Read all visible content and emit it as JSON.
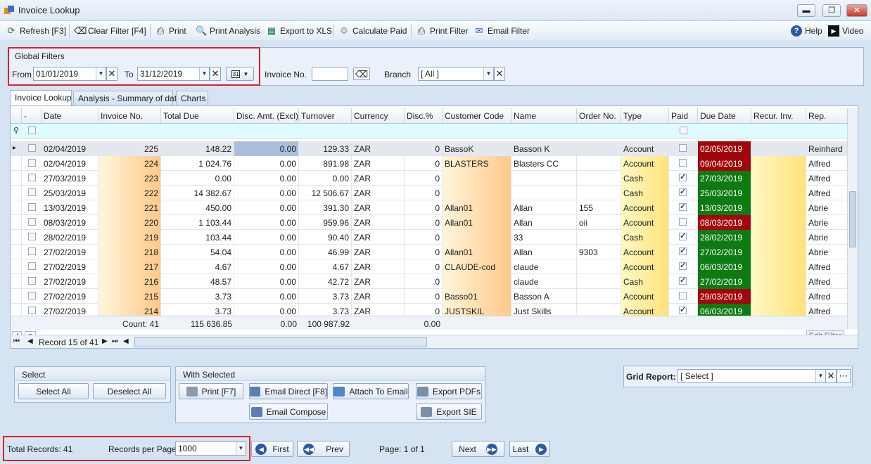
{
  "window": {
    "title": "Invoice Lookup",
    "min": "▬",
    "max": "❐",
    "close": "✕"
  },
  "toolbar": {
    "refresh": "Refresh [F3]",
    "clear_filter": "Clear Filter [F4]",
    "print": "Print",
    "print_analysis": "Print Analysis",
    "export_xls": "Export to XLS",
    "calculate_paid": "Calculate Paid",
    "print_filter": "Print Filter",
    "email_filter": "Email Filter",
    "help": "Help",
    "video": "Video"
  },
  "global_filters": {
    "title": "Global Filters",
    "from_label": "From",
    "from_value": "01/01/2019",
    "to_label": "To",
    "to_value": "31/12/2019",
    "calendar_label": "31",
    "invoice_no_label": "Invoice No.",
    "invoice_no_value": "",
    "branch_label": "Branch",
    "branch_value": "[ All ]"
  },
  "tabs": [
    "Invoice Lookup",
    "Analysis - Summary of data",
    "Charts"
  ],
  "grid": {
    "columns": [
      "-",
      "Date",
      "Invoice No.",
      "Total Due",
      "Disc. Amt. (Excl)",
      "Turnover",
      "Currency",
      "Disc.%",
      "Customer Code",
      "Name",
      "Order No.",
      "Type",
      "Paid",
      "Due Date",
      "Recur. Inv.",
      "Rep."
    ],
    "rows": [
      {
        "date": "02/04/2019",
        "inv": "225",
        "total": "148.22",
        "disc": "0.00",
        "turnover": "129.33",
        "cur": "ZAR",
        "discp": "0",
        "code": "BassoK",
        "name": "Basson K",
        "order": "",
        "type": "Account",
        "paid": false,
        "due": "02/05/2019",
        "due_status": "overdue",
        "rep": "Reinhard"
      },
      {
        "date": "02/04/2019",
        "inv": "224",
        "total": "1 024.76",
        "disc": "0.00",
        "turnover": "891.98",
        "cur": "ZAR",
        "discp": "0",
        "code": "BLASTERS",
        "name": "Blasters CC",
        "order": "",
        "type": "Account",
        "paid": false,
        "due": "09/04/2019",
        "due_status": "overdue",
        "rep": "Alfred"
      },
      {
        "date": "27/03/2019",
        "inv": "223",
        "total": "0.00",
        "disc": "0.00",
        "turnover": "0.00",
        "cur": "ZAR",
        "discp": "0",
        "code": "",
        "name": "",
        "order": "",
        "type": "Cash",
        "paid": true,
        "due": "27/03/2019",
        "due_status": "paid",
        "rep": "Alfred"
      },
      {
        "date": "25/03/2019",
        "inv": "222",
        "total": "14 382.67",
        "disc": "0.00",
        "turnover": "12 506.67",
        "cur": "ZAR",
        "discp": "0",
        "code": "",
        "name": "",
        "order": "",
        "type": "Cash",
        "paid": true,
        "due": "25/03/2019",
        "due_status": "paid",
        "rep": "Alfred"
      },
      {
        "date": "13/03/2019",
        "inv": "221",
        "total": "450.00",
        "disc": "0.00",
        "turnover": "391.30",
        "cur": "ZAR",
        "discp": "0",
        "code": "Allan01",
        "name": "Allan",
        "order": "155",
        "type": "Account",
        "paid": true,
        "due": "13/03/2019",
        "due_status": "paid",
        "rep": "Abrie"
      },
      {
        "date": "08/03/2019",
        "inv": "220",
        "total": "1 103.44",
        "disc": "0.00",
        "turnover": "959.96",
        "cur": "ZAR",
        "discp": "0",
        "code": "Allan01",
        "name": "Allan",
        "order": "oii",
        "type": "Account",
        "paid": false,
        "due": "08/03/2019",
        "due_status": "overdue",
        "rep": "Abrie"
      },
      {
        "date": "28/02/2019",
        "inv": "219",
        "total": "103.44",
        "disc": "0.00",
        "turnover": "90.40",
        "cur": "ZAR",
        "discp": "0",
        "code": "",
        "name": "33",
        "order": "",
        "type": "Cash",
        "paid": true,
        "due": "28/02/2019",
        "due_status": "paid",
        "rep": "Abrie"
      },
      {
        "date": "27/02/2019",
        "inv": "218",
        "total": "54.04",
        "disc": "0.00",
        "turnover": "46.99",
        "cur": "ZAR",
        "discp": "0",
        "code": "Allan01",
        "name": "Allan",
        "order": "9303",
        "type": "Account",
        "paid": true,
        "due": "27/02/2019",
        "due_status": "paid",
        "rep": "Abrie"
      },
      {
        "date": "27/02/2019",
        "inv": "217",
        "total": "4.67",
        "disc": "0.00",
        "turnover": "4.67",
        "cur": "ZAR",
        "discp": "0",
        "code": "CLAUDE-cod",
        "name": "claude",
        "order": "",
        "type": "Account",
        "paid": true,
        "due": "06/03/2019",
        "due_status": "paid",
        "rep": "Alfred"
      },
      {
        "date": "27/02/2019",
        "inv": "216",
        "total": "48.57",
        "disc": "0.00",
        "turnover": "42.72",
        "cur": "ZAR",
        "discp": "0",
        "code": "",
        "name": "claude",
        "order": "",
        "type": "Cash",
        "paid": true,
        "due": "27/02/2019",
        "due_status": "paid",
        "rep": "Alfred"
      },
      {
        "date": "27/02/2019",
        "inv": "215",
        "total": "3.73",
        "disc": "0.00",
        "turnover": "3.73",
        "cur": "ZAR",
        "discp": "0",
        "code": "Basso01",
        "name": "Basson A",
        "order": "",
        "type": "Account",
        "paid": false,
        "due": "29/03/2019",
        "due_status": "overdue",
        "rep": "Alfred"
      },
      {
        "date": "27/02/2019",
        "inv": "214",
        "total": "3.73",
        "disc": "0.00",
        "turnover": "3.73",
        "cur": "ZAR",
        "discp": "0",
        "code": "JUSTSKIL",
        "name": "Just Skills",
        "order": "",
        "type": "Account",
        "paid": true,
        "due": "06/03/2019",
        "due_status": "paid",
        "rep": "Alfred"
      }
    ],
    "summary": {
      "count": "Count: 41",
      "total": "115 636.85",
      "disc": "0.00",
      "turnover": "100 987.92",
      "discp": "0.00"
    },
    "record_nav": "Record 15 of 41",
    "edit_filter": "Edit Filter"
  },
  "select_group": {
    "title": "Select",
    "select_all": "Select All",
    "deselect_all": "Deselect All"
  },
  "with_selected": {
    "title": "With Selected",
    "print": "Print [F7]",
    "email_direct": "Email Direct [F8]",
    "attach_email": "Attach To Email",
    "export_pdfs": "Export PDFs",
    "email_compose": "Email Compose",
    "export_sie": "Export SIE"
  },
  "grid_report": {
    "label": "Grid Report:",
    "value": "[ Select ]"
  },
  "pager": {
    "total_records": "Total Records: 41",
    "records_per_page_label": "Records per Page:",
    "records_per_page": "1000",
    "first": "First",
    "prev": "Prev",
    "page": "Page: 1 of 1",
    "next": "Next",
    "last": "Last"
  },
  "colors": {
    "overdue": "#a3060a",
    "paid": "#0e7a12",
    "highlight": "#e0212a"
  }
}
